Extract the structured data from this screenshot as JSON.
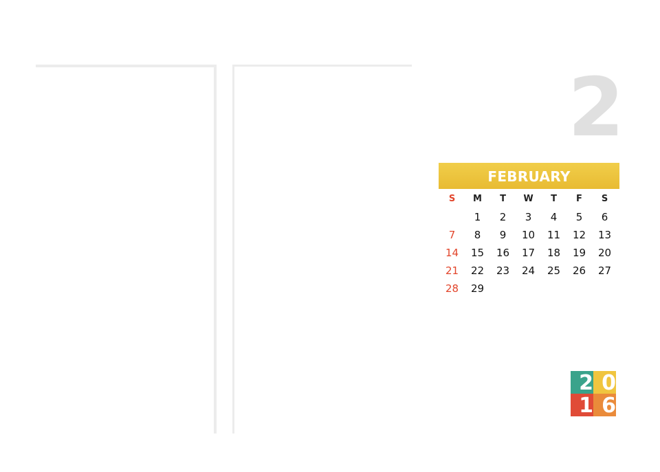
{
  "month_number": "2",
  "month_name": "FEBRUARY",
  "weekday_headers": [
    "S",
    "M",
    "T",
    "W",
    "T",
    "F",
    "S"
  ],
  "days": [
    "",
    "1",
    "2",
    "3",
    "4",
    "5",
    "6",
    "7",
    "8",
    "9",
    "10",
    "11",
    "12",
    "13",
    "14",
    "15",
    "16",
    "17",
    "18",
    "19",
    "20",
    "21",
    "22",
    "23",
    "24",
    "25",
    "26",
    "27",
    "28",
    "29",
    "",
    "",
    "",
    "",
    ""
  ],
  "year_digits": [
    "2",
    "0",
    "1",
    "6"
  ],
  "colors": {
    "banner": "#eac13c",
    "sunday": "#e2452b",
    "month_number": "#e0e0e0",
    "frame_lines": "#ececec",
    "year_tiles": [
      "#3aa38b",
      "#f0c53f",
      "#e04b37",
      "#ea8b3a"
    ]
  }
}
